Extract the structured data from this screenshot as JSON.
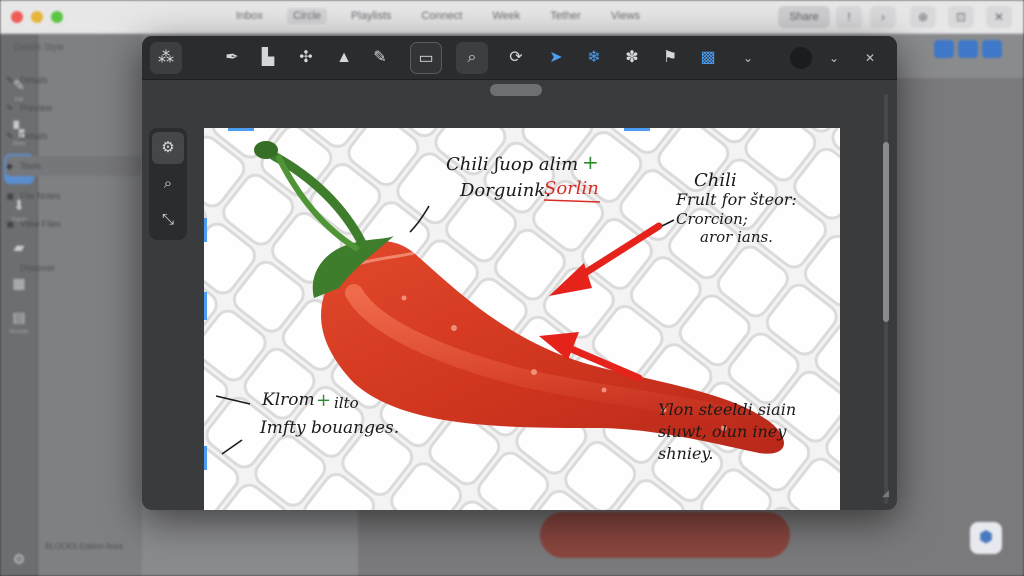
{
  "background_window": {
    "tabs": [
      "Inbox",
      "Circle",
      "Playlists",
      "Connect",
      "Week",
      "Tether",
      "Views"
    ],
    "active_tab": "Circle",
    "share_button": "Share",
    "toolbar_glyphs": [
      "!",
      "›",
      "⊕",
      "⊡",
      "✕"
    ],
    "rail_items": [
      {
        "icon": "✎",
        "caption": "Edit"
      },
      {
        "icon": "▚",
        "caption": "Share"
      },
      {
        "icon": "◈",
        "caption": "Views"
      },
      {
        "icon": "⬇",
        "caption": "Export"
      },
      {
        "icon": "▰",
        "caption": "Tags"
      },
      {
        "icon": "▦",
        "caption": "Grid"
      },
      {
        "icon": "▤",
        "caption": "Records"
      },
      {
        "icon": "⚙",
        "caption": ""
      }
    ],
    "sidebar_header": "Details  Style",
    "sidebar_items": [
      {
        "icon": "✎",
        "label": "Details",
        "badge": ""
      },
      {
        "icon": "✎",
        "label": "Preview",
        "badge": ""
      },
      {
        "icon": "✎",
        "label": "Details",
        "badge": ""
      },
      {
        "icon": "◆",
        "label": "Tools",
        "badge": ""
      },
      {
        "icon": "▣",
        "label": "File Notes",
        "badge": ""
      },
      {
        "icon": "▣",
        "label": "View Files",
        "badge": ""
      },
      {
        "icon": "",
        "label": "Discover",
        "badge": ""
      }
    ],
    "sidebar_footer": "BLOCKS   Edition   Area"
  },
  "editor": {
    "toolbar": [
      {
        "name": "layers-tool",
        "icon": "⁂"
      },
      {
        "name": "pen-tool",
        "icon": "✒"
      },
      {
        "name": "stamp-tool",
        "icon": "▙"
      },
      {
        "name": "crop-tool",
        "icon": "✣"
      },
      {
        "name": "arrow-up-tool",
        "icon": "▲"
      },
      {
        "name": "eraser-tool",
        "icon": "✎"
      },
      {
        "name": "folder-tool",
        "icon": "▭"
      },
      {
        "name": "search-tool",
        "icon": "⌕"
      },
      {
        "name": "rotate-tool",
        "icon": "⟳"
      },
      {
        "name": "select-tool",
        "icon": "➤"
      },
      {
        "name": "snowflake-tool",
        "icon": "❄"
      },
      {
        "name": "bug-tool",
        "icon": "✽"
      },
      {
        "name": "flag-tool",
        "icon": "⚑"
      },
      {
        "name": "palette-tool",
        "icon": "▩"
      },
      {
        "name": "more-tool",
        "icon": "⌄"
      }
    ],
    "side_tools": [
      {
        "name": "settings-tool",
        "icon": "⚙"
      },
      {
        "name": "zoom-tool",
        "icon": "⌕"
      },
      {
        "name": "transform-tool",
        "icon": "⤡"
      }
    ],
    "canvas": {
      "annotations": {
        "top_line1": "Chili ʃuop alim",
        "top_plus": "+",
        "top_line2": "Dorguink.",
        "top_red": "Sorlin",
        "right_1": "Chili",
        "right_2": "Frult for šteor:",
        "right_3": "Crorcion;",
        "right_4": "aror ians.",
        "left_1": "Klrom",
        "left_plus": "+",
        "left_1b": "ilto",
        "left_2": "Imfty bouanges.",
        "bottom_1": "Ylon steeldi siain",
        "bottom_2": "siuwt, olun iney",
        "bottom_3": "shniey."
      },
      "colors": {
        "arrow": "#e5231b",
        "chili_body": "#d53a22",
        "chili_stem": "#3e7d2b",
        "grid_line": "#d8d8d8"
      }
    }
  }
}
